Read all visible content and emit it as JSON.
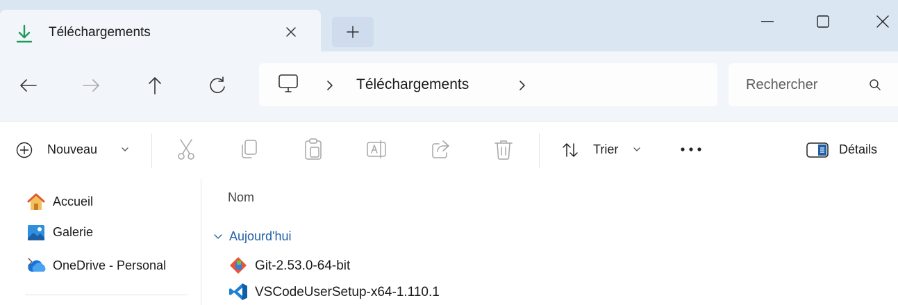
{
  "window": {
    "tab_title": "Téléchargements",
    "tab_icon": "download-icon",
    "controls": [
      "minimize-icon",
      "maximize-icon",
      "close-icon"
    ]
  },
  "address": {
    "location_icon": "computer-icon",
    "breadcrumb": [
      "Téléchargements"
    ],
    "search_placeholder": "Rechercher"
  },
  "commands": {
    "new_label": "Nouveau",
    "sort_label": "Trier",
    "details_label": "Détails",
    "actions": [
      "cut-icon",
      "copy-icon",
      "paste-icon",
      "rename-icon",
      "share-icon",
      "delete-icon"
    ]
  },
  "sidebar": {
    "items": [
      {
        "label": "Accueil",
        "icon": "home-icon"
      },
      {
        "label": "Galerie",
        "icon": "gallery-icon"
      },
      {
        "label": "OneDrive - Personal",
        "icon": "onedrive-icon",
        "expandable": true
      }
    ]
  },
  "filelist": {
    "column_name": "Nom",
    "group_label": "Aujourd'hui",
    "files": [
      {
        "name": "Git-2.53.0-64-bit",
        "icon": "git-icon"
      },
      {
        "name": "VSCodeUserSetup-x64-1.110.1",
        "icon": "vscode-icon"
      }
    ]
  },
  "colors": {
    "titlebar_bg": "#dbe6f3",
    "toolbar_bg": "#f2f5f9",
    "accent": "#1f5fa8"
  }
}
